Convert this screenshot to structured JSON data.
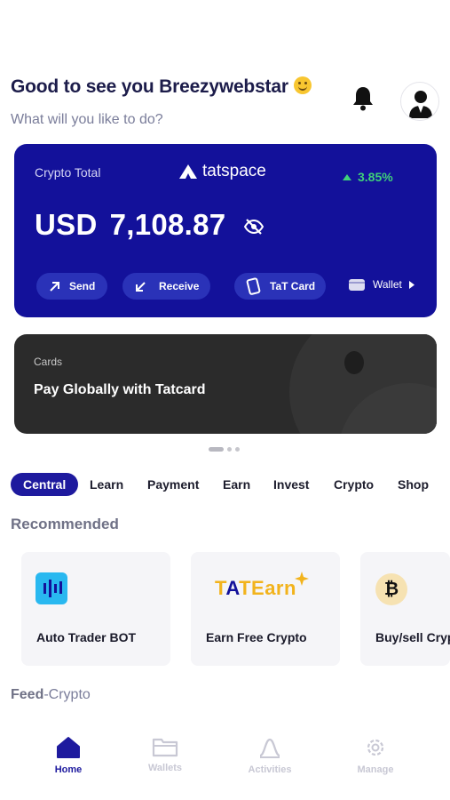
{
  "header": {
    "greeting": "Good to see you Breezywebstar",
    "subtitle": "What will you like to do?"
  },
  "crypto_card": {
    "label": "Crypto Total",
    "brand": "tatspace",
    "change": "3.85%",
    "currency": "USD",
    "amount": "7,108.87",
    "actions": {
      "send": "Send",
      "receive": "Receive",
      "tat_card": "TaT Card",
      "wallet": "Wallet"
    },
    "colors": {
      "background": "#13119a",
      "positive": "#3fd17a"
    }
  },
  "cards_banner": {
    "label": "Cards",
    "headline": "Pay Globally with Tatcard"
  },
  "tabs": [
    "Central",
    "Learn",
    "Payment",
    "Earn",
    "Invest",
    "Crypto",
    "Shop"
  ],
  "active_tab": "Central",
  "recommended": {
    "title": "Recommended",
    "items": [
      {
        "title": "Auto Trader BOT",
        "icon": "chart-bars-icon"
      },
      {
        "title": "Earn Free Crypto",
        "logo_text": "TATEarn",
        "icon": "tatearn-logo"
      },
      {
        "title": "Buy/sell Crypto",
        "icon": "bitcoin-icon"
      }
    ]
  },
  "feed": {
    "label": "Feed",
    "sub": "-Crypto"
  },
  "bottom_nav": {
    "items": [
      {
        "label": "Home",
        "icon": "home-icon"
      },
      {
        "label": "Wallets",
        "icon": "folder-icon"
      },
      {
        "label": "Activities",
        "icon": "activity-icon"
      },
      {
        "label": "Manage",
        "icon": "gear-icon"
      }
    ],
    "active": "Home"
  }
}
